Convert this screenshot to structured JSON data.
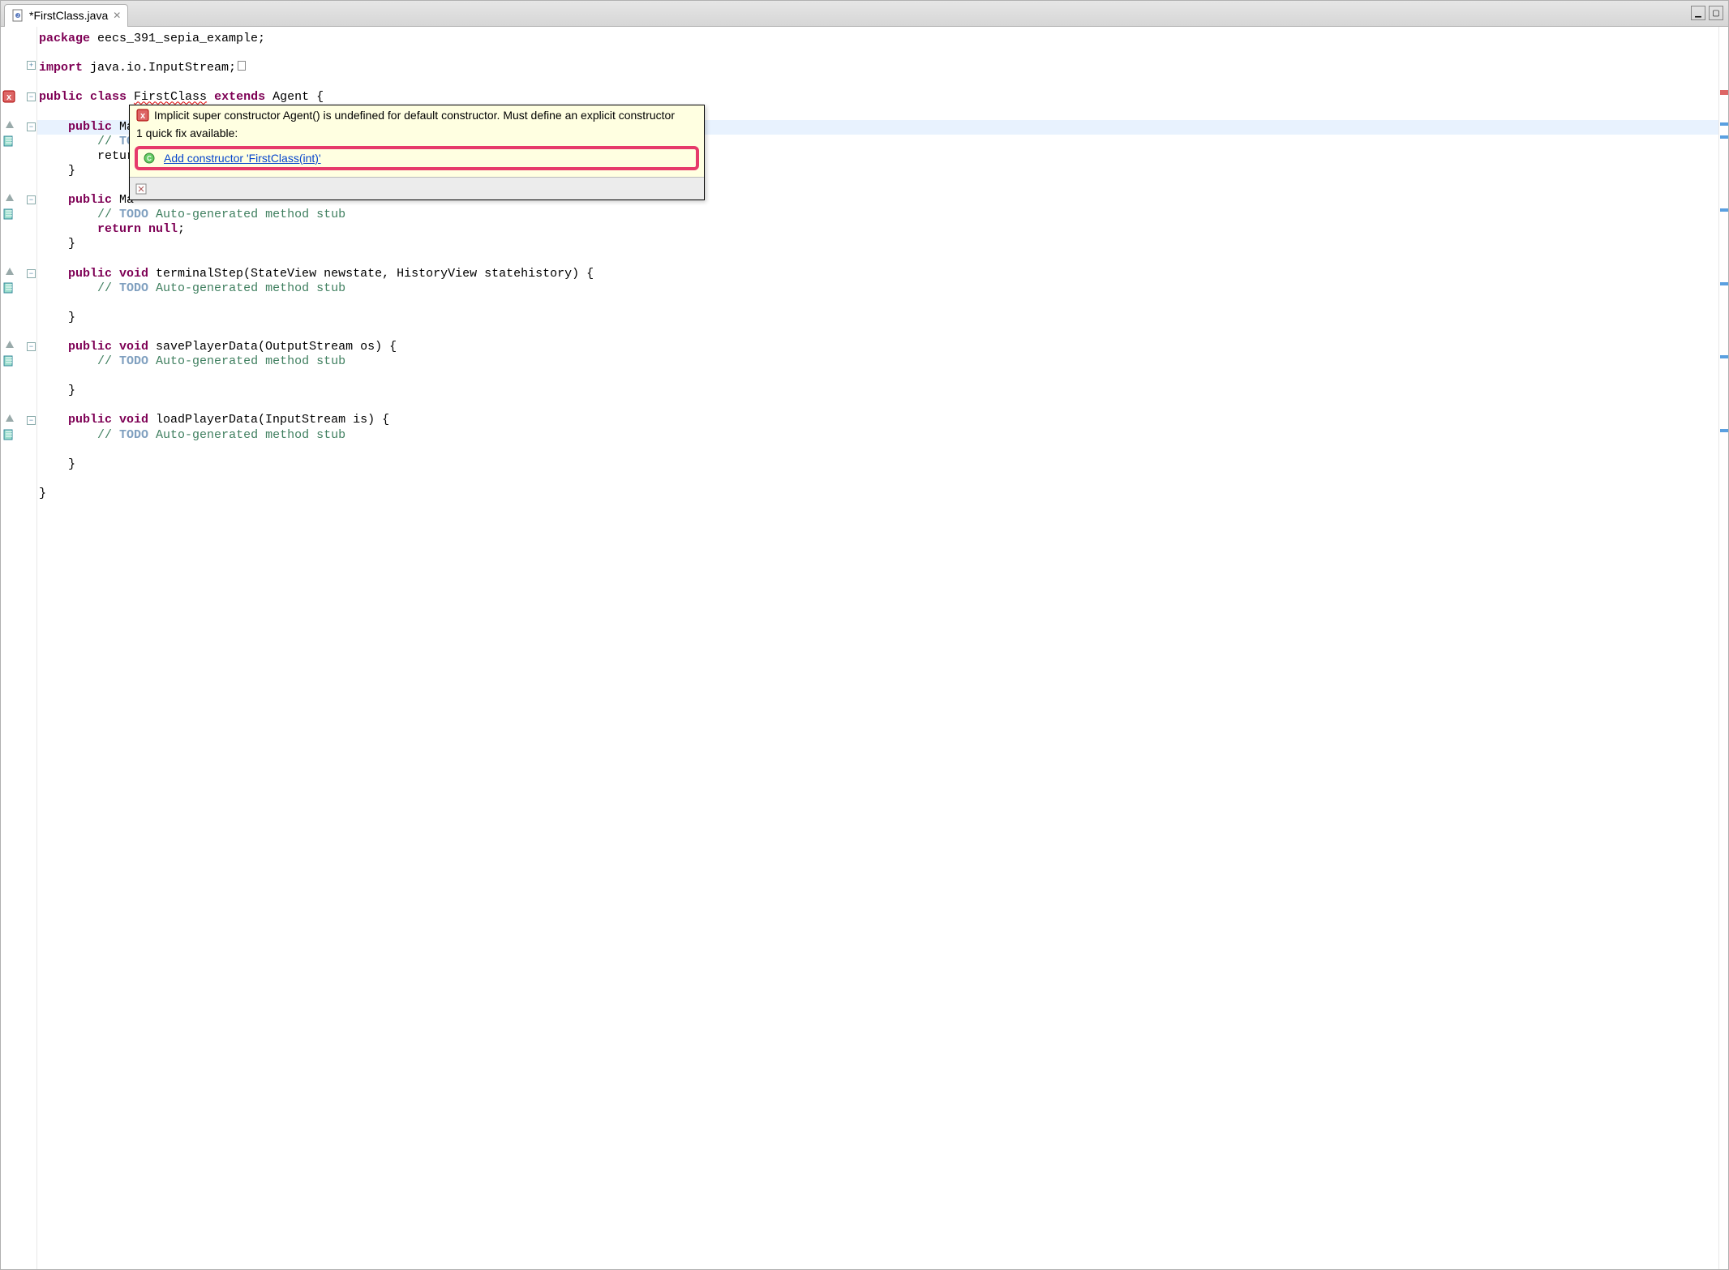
{
  "tab": {
    "title": "*FirstClass.java",
    "close_glyph": "✕"
  },
  "code": {
    "l1a": "package",
    "l1b": " eecs_391_sepia_example;",
    "l3a": "import",
    "l3b": " java.io.InputStream;",
    "l5a": "public",
    "l5b": " class",
    "l5c": " FirstClass ",
    "l5d": "extends",
    "l5e": " Agent {",
    "l7a": "    public",
    "l7b": " Ma",
    "l8a": "        // ",
    "l8b": "TO",
    "l9a": "        retur",
    "l10": "    }",
    "l12a": "    public",
    "l12b": " Ma",
    "l13a": "        // ",
    "l13b": "TODO",
    "l13c": " Auto-generated method stub",
    "l14a": "        return",
    "l14b": " null",
    "l14c": ";",
    "l15": "    }",
    "l17a": "    public",
    "l17b": " void",
    "l17c": " terminalStep(StateView newstate, HistoryView statehistory) {",
    "l18a": "        // ",
    "l18b": "TODO",
    "l18c": " Auto-generated method stub",
    "l20": "    }",
    "l22a": "    public",
    "l22b": " void",
    "l22c": " savePlayerData(OutputStream os) {",
    "l23a": "        // ",
    "l23b": "TODO",
    "l23c": " Auto-generated method stub",
    "l25": "    }",
    "l27a": "    public",
    "l27b": " void",
    "l27c": " loadPlayerData(InputStream is) {",
    "l28a": "        // ",
    "l28b": "TODO",
    "l28c": " Auto-generated method stub",
    "l30": "    }",
    "l32": "}"
  },
  "hover": {
    "message": "Implicit super constructor Agent() is undefined for default constructor. Must define an explicit constructor",
    "count": "1 quick fix available:",
    "fix": "Add constructor 'FirstClass(int)'"
  },
  "window_ctrls": {
    "minimize": "▁",
    "maximize": "▢"
  }
}
